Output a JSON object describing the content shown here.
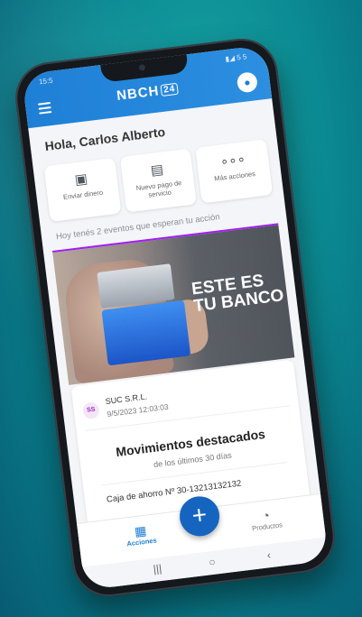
{
  "status": {
    "time": "15:5",
    "icons": "▮◢ 5 5"
  },
  "header": {
    "brand": "NBCH",
    "brand_suffix": "24"
  },
  "home": {
    "greeting": "Hola, Carlos Alberto",
    "actions": [
      {
        "icon": "wallet-icon",
        "label": "Enviar dinero"
      },
      {
        "icon": "bill-icon",
        "label": "Nuevo pago de servicio"
      },
      {
        "icon": "more-dots-icon",
        "label": "Más acciones"
      }
    ],
    "events_text": "Hoy tenés 2 eventos que esperan tu acción"
  },
  "banner": {
    "line1": "ESTE ES",
    "line2": "TU BANCO"
  },
  "summary": {
    "transaction": {
      "badge": "SS",
      "name": "SUC S.R.L.",
      "date": "9/5/2023 12:03:03"
    },
    "title": "Movimientos destacados",
    "subtitle": "de los últimos 30 días",
    "account": "Caja de ahorro Nº 30-13213132132"
  },
  "nav": {
    "left_label": "Acciones",
    "right_label": "Productos",
    "fab": "+"
  },
  "system": {
    "recent": "|||",
    "home": "○",
    "back": "‹"
  },
  "colors": {
    "primary": "#1e7fd6",
    "fab": "#1565c0",
    "accent_purple": "#a020f0"
  }
}
